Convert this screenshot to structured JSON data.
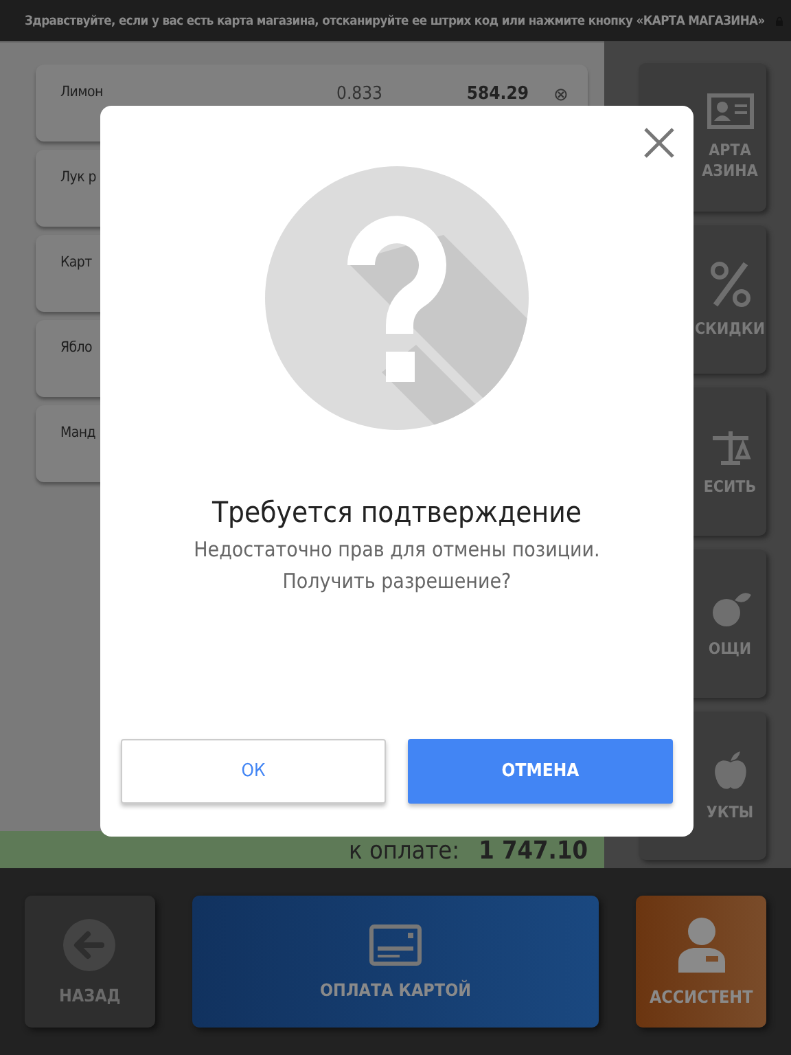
{
  "header": {
    "message": "Здравствуйте, если у вас есть карта магазина, отсканируйте ее штрих код или нажмите кнопку «КАРТА МАГАЗИНА»"
  },
  "items": [
    {
      "name": "Лимон",
      "quantity": "0.833",
      "price": "584.29",
      "remove": "⊗"
    },
    {
      "name": "Лук р"
    },
    {
      "name": "Карт"
    },
    {
      "name": "Ябло"
    },
    {
      "name": "Манд"
    }
  ],
  "sidebar": [
    {
      "kind": "card",
      "label": "АРТА АЗИНА"
    },
    {
      "kind": "discount",
      "label": "СКИДКИ"
    },
    {
      "kind": "scale",
      "label": "ЕСИТЬ"
    },
    {
      "kind": "vegetable",
      "label": "ОЩИ"
    },
    {
      "kind": "fruit",
      "label": "УКТЫ"
    }
  ],
  "total": {
    "label": "к оплате:",
    "amount": "1 747.10"
  },
  "bottom": [
    {
      "kind": "back",
      "label": "НАЗАД",
      "disabled": true
    },
    {
      "kind": "pay",
      "label": "ОПЛАТА КАРТОЙ",
      "disabled": false
    },
    {
      "kind": "assistant",
      "label": "АССИСТЕНТ",
      "disabled": false
    }
  ],
  "dialog": {
    "title": "Требуется подтверждение",
    "message": [
      "Недостаточно прав для отмены позиции.",
      "Получить разрешение?"
    ],
    "buttons": [
      {
        "label": "ОК",
        "kind": "secondary"
      },
      {
        "label": "ОТМЕНА",
        "kind": "primary"
      }
    ]
  }
}
